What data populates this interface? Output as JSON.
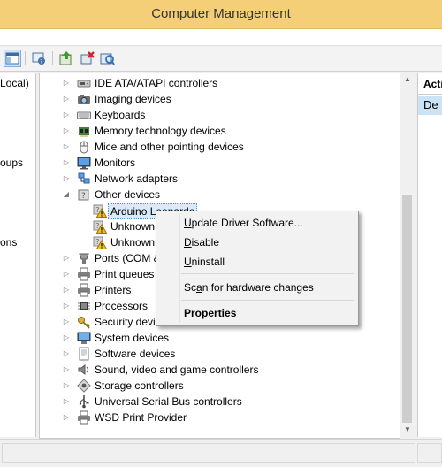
{
  "window": {
    "title": "Computer Management"
  },
  "left_pane": {
    "fragments": [
      "Local)",
      "oups",
      "ons"
    ]
  },
  "right_pane": {
    "header": "Acti",
    "selected": "De"
  },
  "device_tree": {
    "items": [
      {
        "label": "IDE ATA/ATAPI controllers",
        "icon": "ide-controller-icon",
        "expander": "collapsed"
      },
      {
        "label": "Imaging devices",
        "icon": "camera-icon",
        "expander": "collapsed"
      },
      {
        "label": "Keyboards",
        "icon": "keyboard-icon",
        "expander": "collapsed"
      },
      {
        "label": "Memory technology devices",
        "icon": "memory-card-icon",
        "expander": "collapsed"
      },
      {
        "label": "Mice and other pointing devices",
        "icon": "mouse-icon",
        "expander": "collapsed"
      },
      {
        "label": "Monitors",
        "icon": "monitor-icon",
        "expander": "collapsed"
      },
      {
        "label": "Network adapters",
        "icon": "network-adapter-icon",
        "expander": "collapsed"
      },
      {
        "label": "Other devices",
        "icon": "unknown-device-icon",
        "expander": "expanded"
      },
      {
        "label": "Arduino Leonardo",
        "icon": "warning-device-icon",
        "child": true,
        "selected": true
      },
      {
        "label": "Unknown device",
        "icon": "warning-device-icon",
        "child": true
      },
      {
        "label": "Unknown device",
        "icon": "warning-device-icon",
        "child": true
      },
      {
        "label": "Ports (COM & LPT)",
        "icon": "port-icon",
        "expander": "collapsed"
      },
      {
        "label": "Print queues",
        "icon": "printer-icon",
        "expander": "collapsed"
      },
      {
        "label": "Printers",
        "icon": "printer-icon",
        "expander": "collapsed"
      },
      {
        "label": "Processors",
        "icon": "processor-icon",
        "expander": "collapsed"
      },
      {
        "label": "Security devices",
        "icon": "security-key-icon",
        "expander": "collapsed"
      },
      {
        "label": "System devices",
        "icon": "system-device-icon",
        "expander": "collapsed"
      },
      {
        "label": "Software devices",
        "icon": "software-device-icon",
        "expander": "collapsed"
      },
      {
        "label": "Sound, video and game controllers",
        "icon": "speaker-icon",
        "expander": "collapsed"
      },
      {
        "label": "Storage controllers",
        "icon": "storage-controller-icon",
        "expander": "collapsed"
      },
      {
        "label": "Universal Serial Bus controllers",
        "icon": "usb-icon",
        "expander": "collapsed"
      },
      {
        "label": "WSD Print Provider",
        "icon": "printer-icon",
        "expander": "collapsed"
      }
    ]
  },
  "context_menu": {
    "items": [
      {
        "label": "Update Driver Software...",
        "accel": "U"
      },
      {
        "label": "Disable",
        "accel": "D"
      },
      {
        "label": "Uninstall",
        "accel": "U"
      },
      {
        "label": "Scan for hardware changes",
        "accel": "a"
      },
      {
        "label": "Properties",
        "accel": "P",
        "bold": true
      }
    ]
  },
  "colors": {
    "titlebar": "#f5ce78",
    "selection": "#cce3f5",
    "menu_bg": "#f2f2f2"
  }
}
